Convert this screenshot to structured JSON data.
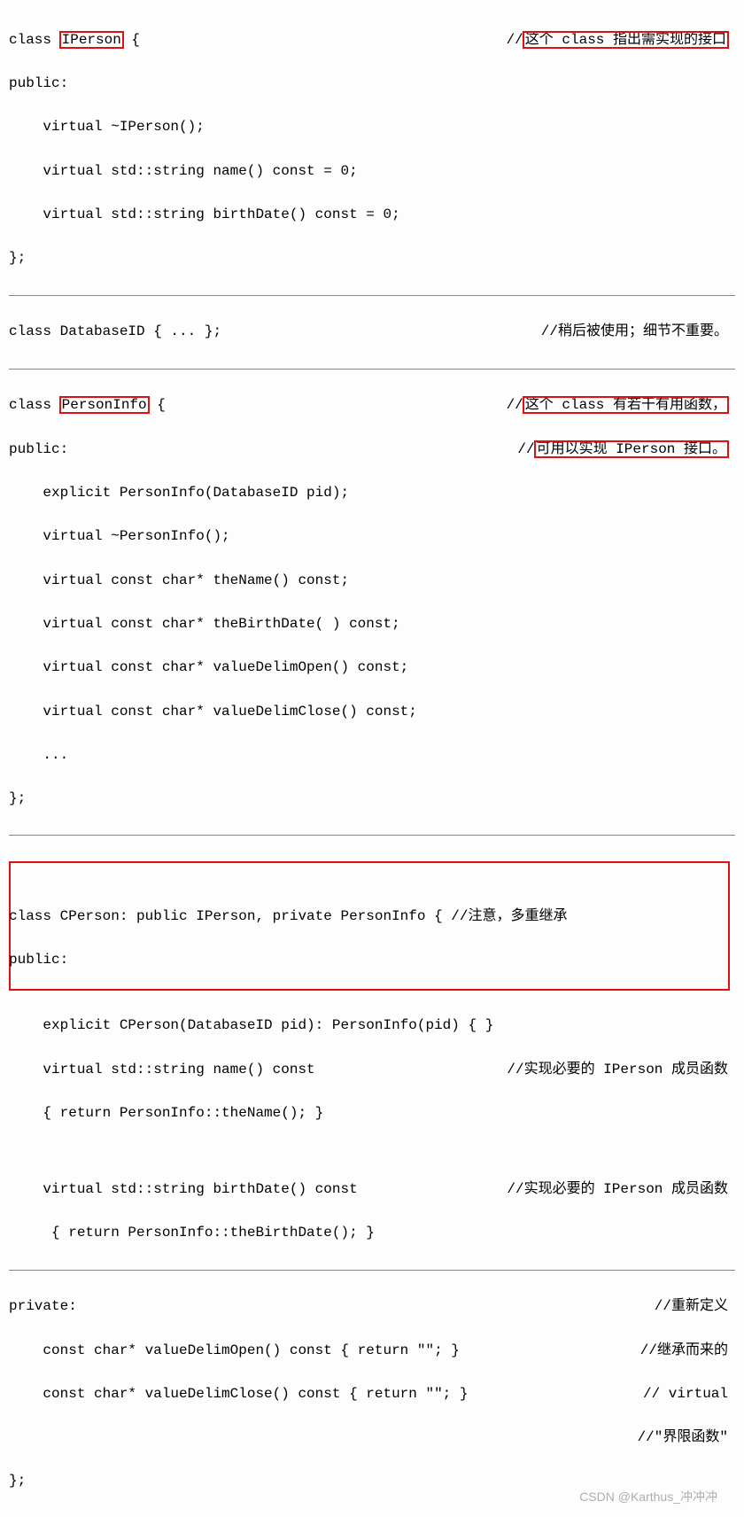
{
  "lines": {
    "l1a": "class ",
    "l1b": "IPerson",
    "l1c": " {",
    "c1a": "//",
    "c1b": "这个 class 指出需实现的接口",
    "l2": "public:",
    "l3": "    virtual ~IPerson();",
    "l4": "    virtual std::string name() const = 0;",
    "l5": "    virtual std::string birthDate() const = 0;",
    "l6": "};",
    "l7": "class DatabaseID { ... };",
    "c7": "//稍后被使用；细节不重要。",
    "l8a": "class ",
    "l8b": "PersonInfo",
    "l8c": " {",
    "c8a": "//",
    "c8b": "这个 class 有若干有用函数，",
    "l9": "public:",
    "c9a": "//",
    "c9b": "可用以实现 IPerson 接口。",
    "l10": "    explicit PersonInfo(DatabaseID pid);",
    "l11": "    virtual ~PersonInfo();",
    "l12": "    virtual const char* theName() const;",
    "l13": "    virtual const char* theBirthDate( ) const;",
    "l14": "    virtual const char* valueDelimOpen() const;",
    "l15": "    virtual const char* valueDelimClose() const;",
    "l16": "    ...",
    "l17": "};",
    "l18": "class CPerson: public IPerson, private PersonInfo { //注意，多重继承",
    "l19": "public:",
    "l20": "    explicit CPerson(DatabaseID pid): PersonInfo(pid) { }",
    "l21": "    virtual std::string name() const",
    "c21": "//实现必要的 IPerson 成员函数",
    "l22": "    { return PersonInfo::theName(); }",
    "l23": "    virtual std::string birthDate() const",
    "c23": "//实现必要的 IPerson 成员函数",
    "l24": "     { return PersonInfo::theBirthDate(); }",
    "l25": "private:",
    "c25": "//重新定义",
    "l26": "    const char* valueDelimOpen() const { return \"\"; }",
    "c26": "//继承而来的",
    "l27": "    const char* valueDelimClose() const { return \"\"; }",
    "c27": "// virtual",
    "c28": "//\"界限函数\"",
    "l29": "};"
  },
  "watermark": "CSDN @Karthus_冲冲冲"
}
